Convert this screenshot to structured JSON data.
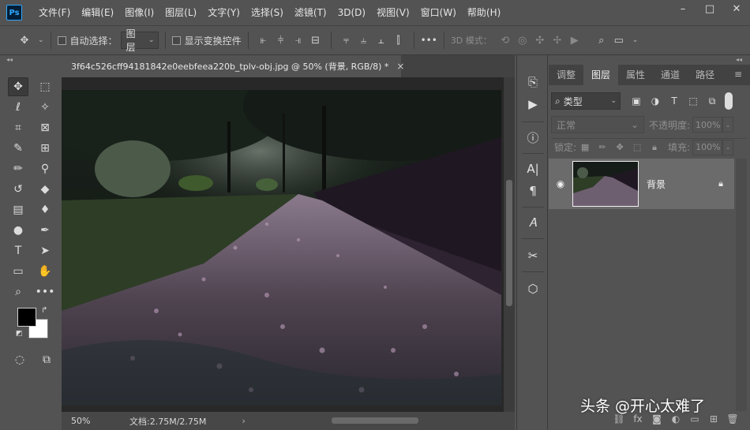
{
  "app": {
    "logo_text": "Ps"
  },
  "menu": [
    "文件(F)",
    "编辑(E)",
    "图像(I)",
    "图层(L)",
    "文字(Y)",
    "选择(S)",
    "滤镜(T)",
    "3D(D)",
    "视图(V)",
    "窗口(W)",
    "帮助(H)"
  ],
  "window_controls": {
    "minimize": "–",
    "restore": "□",
    "close": "✕"
  },
  "options_bar": {
    "auto_select_label": "自动选择：",
    "auto_select_target": "图层",
    "show_transform_label": "显示变换控件",
    "more_label": "•••",
    "mode_3d_label": "3D 模式："
  },
  "document": {
    "tab_title": "3f64c526cff94181842e0eebfeea220b_tplv-obj.jpg @ 50% (背景, RGB/8) *",
    "close_glyph": "×",
    "zoom": "50%",
    "doc_info": "文档:2.75M/2.75M",
    "status_arrow": "›"
  },
  "layers_panel": {
    "tabs": [
      {
        "label": "调整"
      },
      {
        "label": "图层"
      },
      {
        "label": "属性"
      },
      {
        "label": "通道"
      },
      {
        "label": "路径"
      }
    ],
    "active_tab": "图层",
    "filter_label": "类型",
    "blend_mode": "正常",
    "opacity_label": "不透明度:",
    "opacity_value": "100%",
    "lock_label": "锁定:",
    "fill_label": "填充:",
    "fill_value": "100%",
    "layers": [
      {
        "name": "背景",
        "visible": true,
        "locked": true
      }
    ]
  },
  "watermark": "头条 @开心太难了",
  "icons": {
    "move": "move-icon",
    "marquee": "rect-marquee-icon",
    "lasso": "lasso-icon",
    "magic_wand": "magic-wand-icon",
    "crop": "crop-icon",
    "frame": "frame-icon",
    "eyedropper": "eyedropper-icon",
    "healing": "healing-brush-icon",
    "brush": "brush-icon",
    "stamp": "clone-stamp-icon",
    "history_brush": "history-brush-icon",
    "eraser": "eraser-icon",
    "gradient": "gradient-icon",
    "blur": "blur-icon",
    "dodge": "dodge-icon",
    "pen": "pen-icon",
    "type": "type-icon",
    "path_select": "path-select-icon",
    "shape": "rectangle-icon",
    "hand": "hand-icon",
    "zoom": "zoom-icon",
    "more": "more-tools-icon"
  }
}
